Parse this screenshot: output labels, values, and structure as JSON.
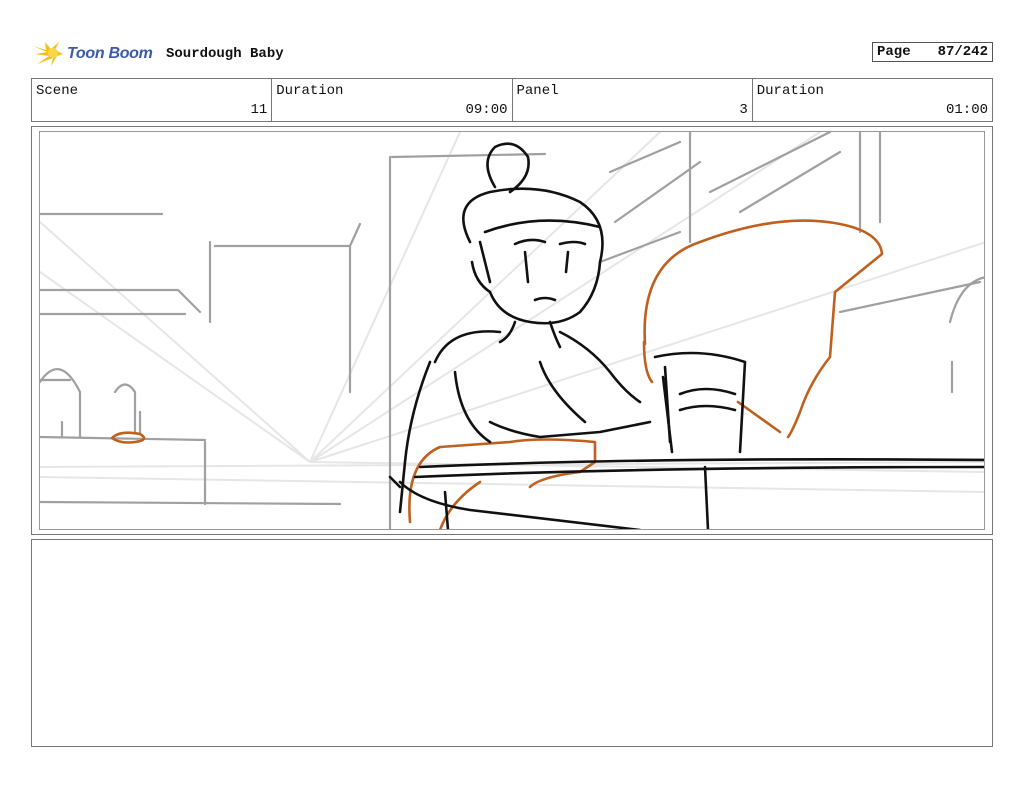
{
  "header": {
    "logo_text": "Toon Boom",
    "project_title": "Sourdough Baby",
    "page_label": "Page",
    "page_number": "87/242"
  },
  "info": {
    "scene_label": "Scene",
    "scene_value": "11",
    "scene_duration_label": "Duration",
    "scene_duration_value": "09:00",
    "panel_label": "Panel",
    "panel_value": "3",
    "panel_duration_label": "Duration",
    "panel_duration_value": "01:00"
  },
  "colors": {
    "logo_blue": "#3b5aa8",
    "logo_yellow": "#f2c21b",
    "sketch_orange": "#c0601f"
  }
}
